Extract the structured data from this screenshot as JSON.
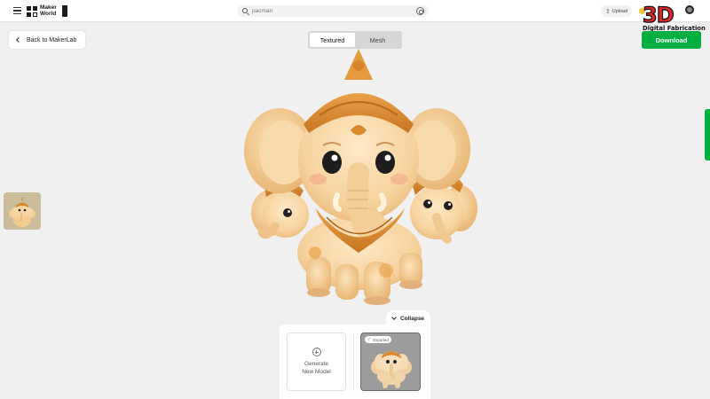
{
  "header": {
    "logo": "Maker World",
    "search_placeholder": "pacman",
    "upload_label": "Upload"
  },
  "watermark": {
    "title": "3D",
    "subtitle": "Digital Fabrication"
  },
  "toolbar": {
    "back_label": "Back to MakerLab",
    "tabs": [
      {
        "label": "Textured",
        "active": true
      },
      {
        "label": "Mesh",
        "active": false
      }
    ],
    "download_label": "Download"
  },
  "panel": {
    "collapse_label": "Collapse",
    "generate_line1": "Generate",
    "generate_line2": "New Model",
    "exported_label": "Exported"
  },
  "colors": {
    "accent": "#00ae42",
    "brand_red": "#e4262b"
  }
}
